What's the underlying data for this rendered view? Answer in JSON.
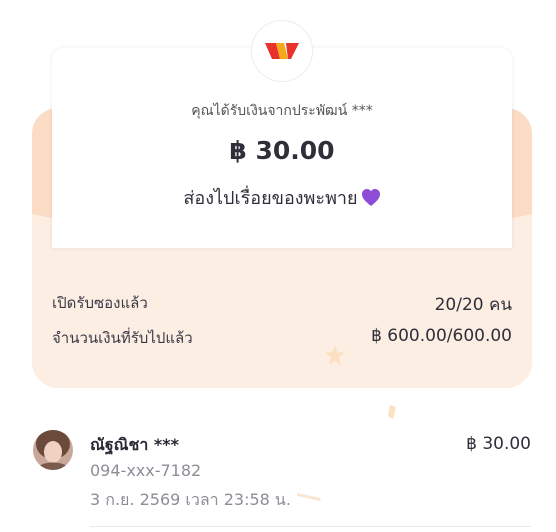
{
  "header": {
    "logo_icon": "wallet-w-logo-icon"
  },
  "envelope": {
    "sender_text": "คุณได้รับเงินจากประพัฒน์ ***",
    "amount": "฿ 30.00",
    "message": "ส่องไปเรื่อยของพะพาย",
    "message_icon": "purple-heart-icon"
  },
  "stats": {
    "opened_label": "เปิดรับซองแล้ว",
    "opened_value": "20/20 คน",
    "received_label": "จำนวนเงินที่รับไปแล้ว",
    "received_value": "฿ 600.00/600.00"
  },
  "recipients": [
    {
      "name": "ณัฐณิชา ***",
      "amount": "฿ 30.00",
      "phone": "094-xxx-7182",
      "datetime": "3 ก.ย. 2569 เวลา 23:58 น."
    }
  ],
  "colors": {
    "envelope_light": "#fdeee3",
    "envelope_band": "#fcdcc4",
    "heart": "#8e4bd6",
    "logo_red": "#e8332b",
    "logo_yellow": "#f7a81b"
  }
}
